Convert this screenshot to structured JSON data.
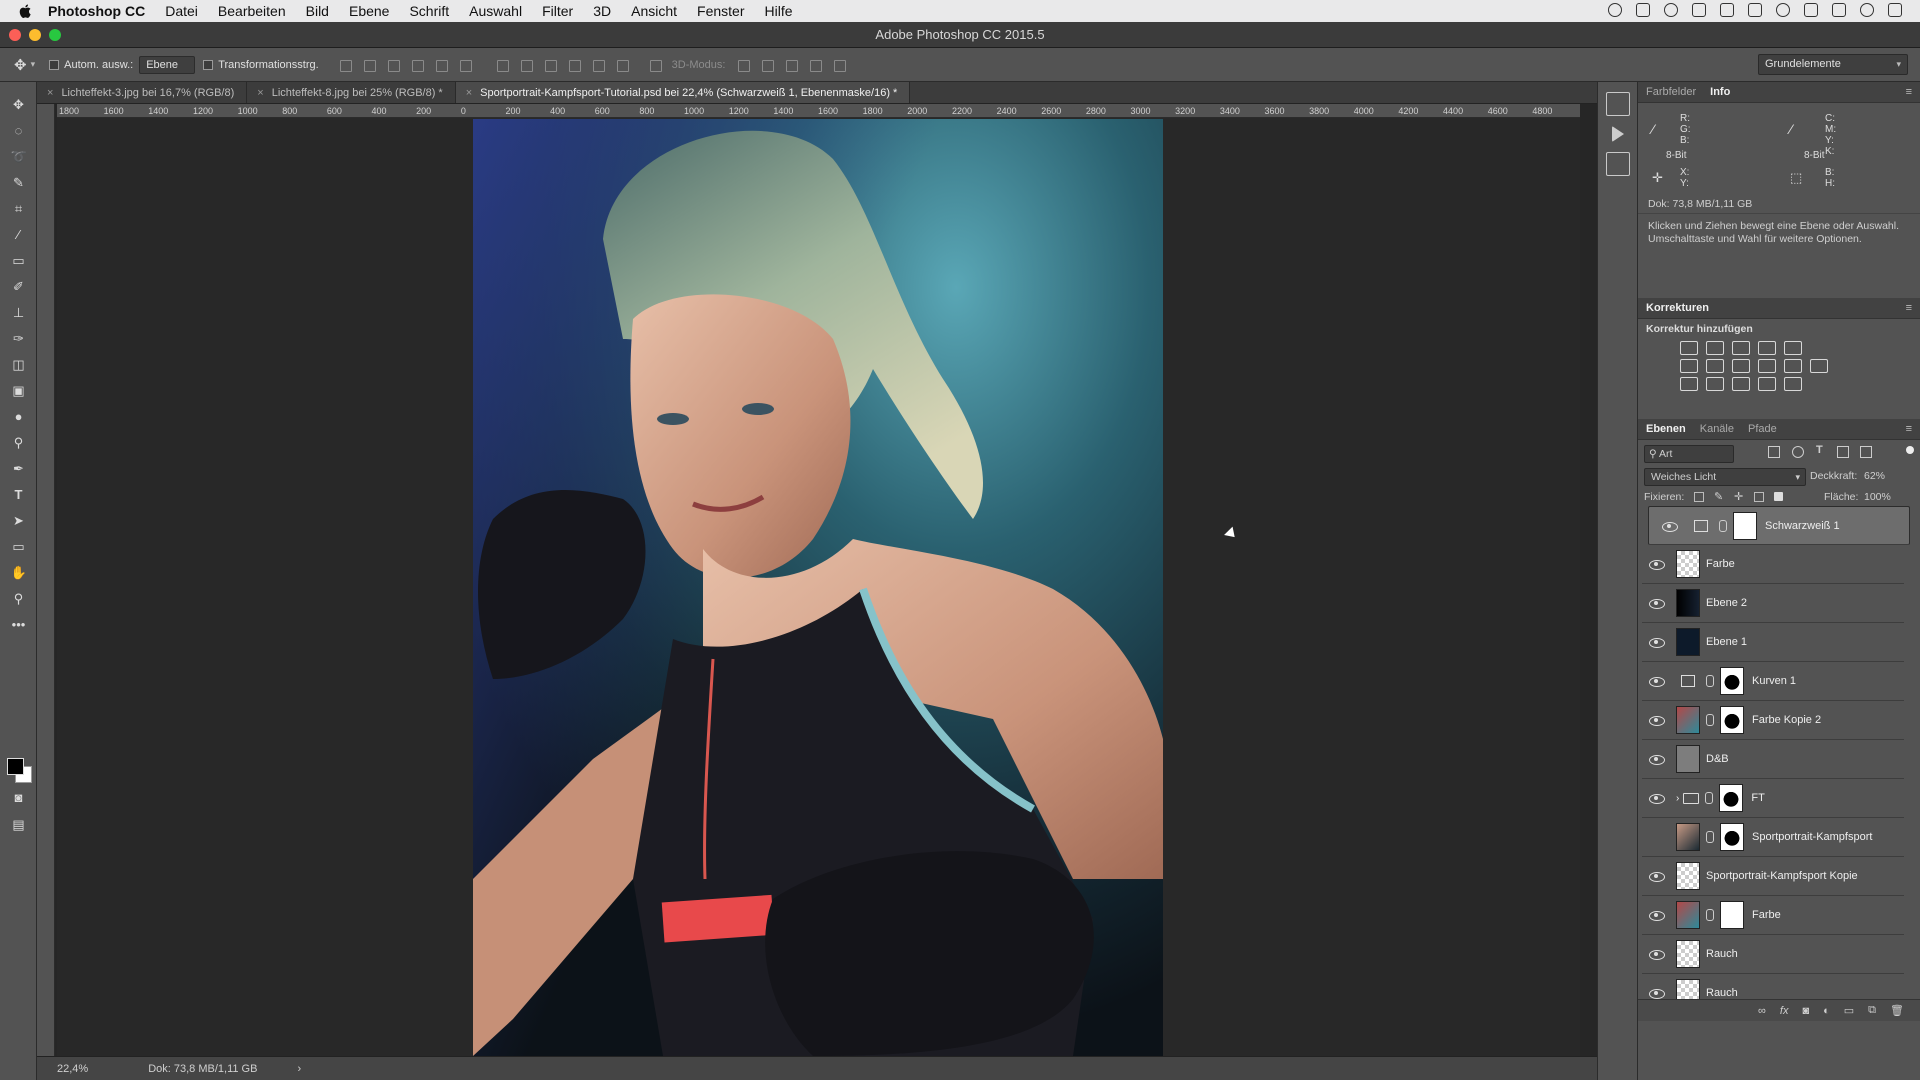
{
  "menubar": {
    "app": "Photoshop CC",
    "items": [
      "Datei",
      "Bearbeiten",
      "Bild",
      "Ebene",
      "Schrift",
      "Auswahl",
      "Filter",
      "3D",
      "Ansicht",
      "Fenster",
      "Hilfe"
    ]
  },
  "window": {
    "title": "Adobe Photoshop CC 2015.5"
  },
  "options": {
    "auto_select_label": "Autom. ausw.:",
    "auto_select_value": "Ebene",
    "transform_label": "Transformationsstrg.",
    "mode_label": "3D-Modus:",
    "workspace": "Grundelemente"
  },
  "tabs": [
    {
      "label": "Lichteffekt-3.jpg bei 16,7% (RGB/8)"
    },
    {
      "label": "Lichteffekt-8.jpg bei 25% (RGB/8) *"
    },
    {
      "label": "Sportportrait-Kampfsport-Tutorial.psd bei 22,4% (Schwarzweiß 1, Ebenenmaske/16) *"
    }
  ],
  "ruler_h": [
    "1800",
    "1600",
    "1400",
    "1200",
    "1000",
    "800",
    "600",
    "400",
    "200",
    "0",
    "200",
    "400",
    "600",
    "800",
    "1000",
    "1200",
    "1400",
    "1600",
    "1800",
    "2000",
    "2200",
    "2400",
    "2600",
    "2800",
    "3000",
    "3200",
    "3400",
    "3600",
    "3800",
    "4000",
    "4200",
    "4400",
    "4600",
    "4800"
  ],
  "status": {
    "zoom": "22,4%",
    "doc": "Dok: 73,8 MB/1,11 GB"
  },
  "info_panel": {
    "tabs": [
      "Farbfelder",
      "Info"
    ],
    "rgb": [
      "R:",
      "G:",
      "B:"
    ],
    "cmyk": [
      "C:",
      "M:",
      "Y:",
      "K:"
    ],
    "bit_left": "8-Bit",
    "bit_right": "8-Bit",
    "xy": [
      "X:",
      "Y:"
    ],
    "bh": [
      "B:",
      "H:"
    ],
    "doc": "Dok: 73,8 MB/1,11 GB",
    "hint": "Klicken und Ziehen bewegt eine Ebene oder Auswahl. Umschalttaste und Wahl für weitere Optionen."
  },
  "corrections": {
    "title": "Korrekturen",
    "subtitle": "Korrektur hinzufügen"
  },
  "layers_panel": {
    "tabs": [
      "Ebenen",
      "Kanäle",
      "Pfade"
    ],
    "filter": "Art",
    "blend_mode": "Weiches Licht",
    "opacity_label": "Deckkraft:",
    "opacity": "62%",
    "lock_label": "Fixieren:",
    "fill_label": "Fläche:",
    "fill": "100%",
    "layers": [
      {
        "name": "Schwarzweiß 1",
        "selected": true
      },
      {
        "name": "Farbe"
      },
      {
        "name": "Ebene 2"
      },
      {
        "name": "Ebene 1"
      },
      {
        "name": "Kurven 1"
      },
      {
        "name": "Farbe Kopie 2"
      },
      {
        "name": "D&B"
      },
      {
        "name": "FT"
      },
      {
        "name": "Sportportrait-Kampfsport",
        "hidden": true
      },
      {
        "name": "Sportportrait-Kampfsport Kopie"
      },
      {
        "name": "Farbe"
      },
      {
        "name": "Rauch"
      },
      {
        "name": "Rauch"
      }
    ]
  },
  "colors": {
    "ui_dark": "#535353",
    "canvas_bg": "#282828",
    "selected_layer": "#6d6d6d"
  }
}
